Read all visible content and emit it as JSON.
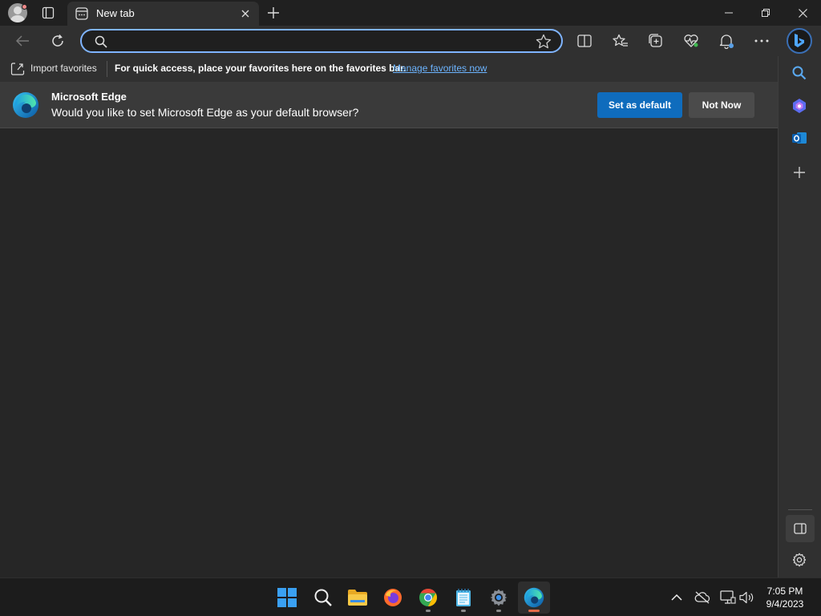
{
  "tab": {
    "title": "New tab"
  },
  "address": {
    "value": "",
    "placeholder": ""
  },
  "favorites_bar": {
    "import_label": "Import favorites",
    "message": "For quick access, place your favorites here on the favorites bar.",
    "manage_link": "Manage favorites now"
  },
  "infobar": {
    "app_name": "Microsoft Edge",
    "question": "Would you like to set Microsoft Edge as your default browser?",
    "primary_button": "Set as default",
    "secondary_button": "Not Now"
  },
  "clock": {
    "time": "7:05 PM",
    "date": "9/4/2023"
  },
  "colors": {
    "accent": "#0f6cbd",
    "link": "#6cb4ff",
    "address_border": "#7fb4ff"
  }
}
